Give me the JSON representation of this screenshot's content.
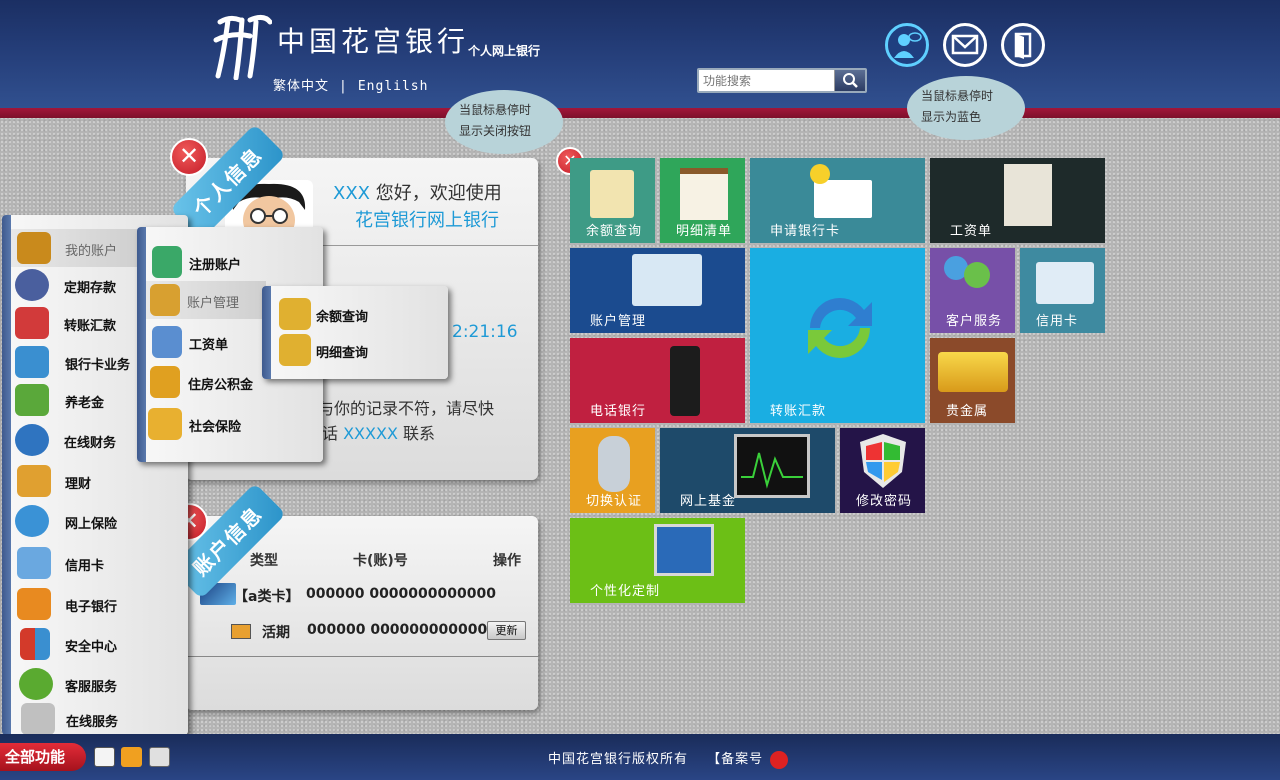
{
  "header": {
    "bank_name": "中国花宫银行",
    "bank_sub": "个人网上银行",
    "lang_traditional": "繁体中文",
    "lang_sep": "|",
    "lang_english": "Englilsh",
    "search_placeholder": "功能搜索"
  },
  "tooltips": {
    "hover_blue_1": "当鼠标悬停时",
    "hover_blue_2": "显示为蓝色",
    "hover_close_1": "当鼠标悬停时",
    "hover_close_2": "显示关闭按钮"
  },
  "personal": {
    "ribbon": "个人信息",
    "greet_user": "XXX",
    "greet_text": " 您好，欢迎使用",
    "greet_bank": "花宫银行网上银行",
    "time_fragment": "2:21:16",
    "notice_line1": "与你的记录不符，请尽快",
    "notice_line2_prefix": "话 ",
    "notice_phone": "XXXXX",
    "notice_line2_suffix": " 联系"
  },
  "account": {
    "ribbon": "账户信息",
    "col_type": "类型",
    "col_card": "卡(账)号",
    "col_op": "操作",
    "rows": [
      {
        "type": "【a类卡】",
        "number": "000000 0000000000000"
      },
      {
        "type": "活期",
        "number": "000000 0000000000000",
        "action": "更新"
      }
    ]
  },
  "menu_main": [
    {
      "label": "我的账户",
      "icon": "wallet-icon",
      "color": "#c98a1c"
    },
    {
      "label": "定期存款",
      "icon": "clock-icon",
      "color": "#4a5f9e"
    },
    {
      "label": "转账汇款",
      "icon": "transfer-icon",
      "color": "#d23a3a"
    },
    {
      "label": "银行卡业务",
      "icon": "bank-card-icon",
      "color": "#3a8fd0"
    },
    {
      "label": "养老金",
      "icon": "money-bag-icon",
      "color": "#5aa83a"
    },
    {
      "label": "在线财务",
      "icon": "globe-icon",
      "color": "#2f74c0"
    },
    {
      "label": "理财",
      "icon": "investment-icon",
      "color": "#e0a030"
    },
    {
      "label": "网上保险",
      "icon": "insurance-globe-icon",
      "color": "#3a92d6"
    },
    {
      "label": "信用卡",
      "icon": "credit-card-user-icon",
      "color": "#6aa8e0"
    },
    {
      "label": "电子银行",
      "icon": "shopping-cart-icon",
      "color": "#e88a20"
    },
    {
      "label": "安全中心",
      "icon": "shield-icon",
      "color": "#d33a2a"
    },
    {
      "label": "客服服务",
      "icon": "headset-icon",
      "color": "#5aaa30"
    },
    {
      "label": "在线服务",
      "icon": "online-service-icon",
      "color": "#c0c0c0"
    }
  ],
  "menu_sub1": [
    {
      "label": "注册账户",
      "icon": "register-icon",
      "color": "#3aa868"
    },
    {
      "label": "账户管理",
      "icon": "account-manage-icon",
      "color": "#d8a030"
    },
    {
      "label": "工资单",
      "icon": "payslip-icon",
      "color": "#5a8ed0"
    },
    {
      "label": "住房公积金",
      "icon": "housing-fund-icon",
      "color": "#e0a020"
    },
    {
      "label": "社会保险",
      "icon": "social-insurance-icon",
      "color": "#e8b030"
    }
  ],
  "menu_sub2": [
    {
      "label": "余额查询",
      "icon": "folder-icon",
      "color": "#e0b030"
    },
    {
      "label": "明细查询",
      "icon": "folder-icon",
      "color": "#e0b030"
    }
  ],
  "tiles": {
    "balance": "余额查询",
    "detail": "明细清单",
    "apply_card": "申请银行卡",
    "payslip": "工资单",
    "acct_manage": "账户管理",
    "transfer": "转账汇款",
    "customer_service": "客户服务",
    "credit_card": "信用卡",
    "phone_bank": "电话银行",
    "precious_metal": "贵金属",
    "switch_auth": "切换认证",
    "online_fund": "网上基金",
    "change_pwd": "修改密码",
    "personalize": "个性化定制"
  },
  "footer": {
    "all_functions": "全部功能",
    "copyright": "中国花宫银行版权所有",
    "icp": "【备案号"
  },
  "colors": {
    "header": "#243d78",
    "stripe": "#a2163a",
    "accent_blue": "#1e9ad6"
  }
}
